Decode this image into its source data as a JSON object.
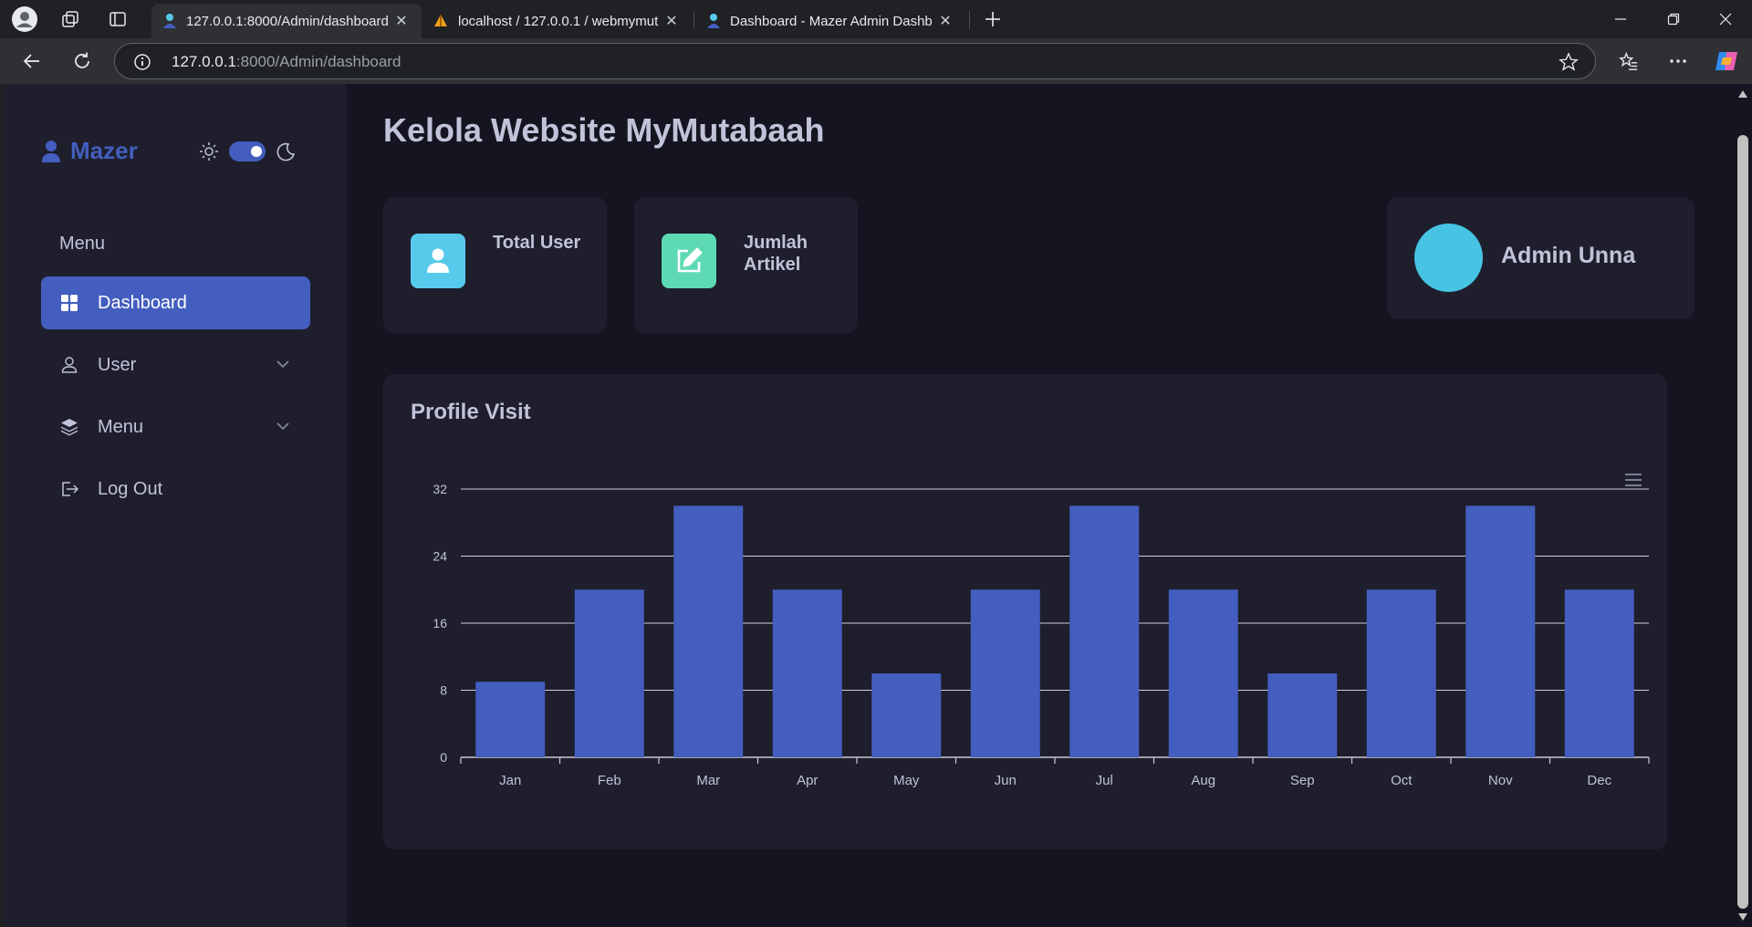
{
  "browser": {
    "tabs": [
      {
        "title": "127.0.0.1:8000/Admin/dashboard",
        "active": true
      },
      {
        "title": "localhost / 127.0.0.1 / webmymut",
        "active": false
      },
      {
        "title": "Dashboard - Mazer Admin Dashb",
        "active": false
      }
    ],
    "address": {
      "host": "127.0.0.1",
      "rest": ":8000/Admin/dashboard"
    }
  },
  "sidebar": {
    "brand": "Mazer",
    "menu_title": "Menu",
    "items": [
      {
        "label": "Dashboard",
        "icon": "grid-icon",
        "active": true
      },
      {
        "label": "User",
        "icon": "person-icon",
        "dropdown": true
      },
      {
        "label": "Menu",
        "icon": "stack-icon",
        "dropdown": true
      },
      {
        "label": "Log Out",
        "icon": "logout-icon"
      }
    ]
  },
  "main": {
    "title": "Kelola Website MyMutabaah",
    "stats": [
      {
        "label": "Total User",
        "icon": "person-icon",
        "color": "#57caeb"
      },
      {
        "label": "Jumlah Artikel",
        "icon": "edit-icon",
        "color": "#5ddab4"
      }
    ],
    "profile": {
      "name": "Admin Unna"
    },
    "chart_title": "Profile Visit"
  },
  "colors": {
    "accent": "#435ebe",
    "sidebar_bg": "#1e1e2d",
    "page_bg": "#151521"
  },
  "chart_data": {
    "type": "bar",
    "title": "Profile Visit",
    "categories": [
      "Jan",
      "Feb",
      "Mar",
      "Apr",
      "May",
      "Jun",
      "Jul",
      "Aug",
      "Sep",
      "Oct",
      "Nov",
      "Dec"
    ],
    "values": [
      9,
      20,
      30,
      20,
      10,
      20,
      30,
      20,
      10,
      20,
      30,
      20
    ],
    "yticks": [
      0,
      8,
      16,
      24,
      32
    ],
    "ylim": [
      0,
      32
    ],
    "color": "#435ebe",
    "grid": true
  }
}
